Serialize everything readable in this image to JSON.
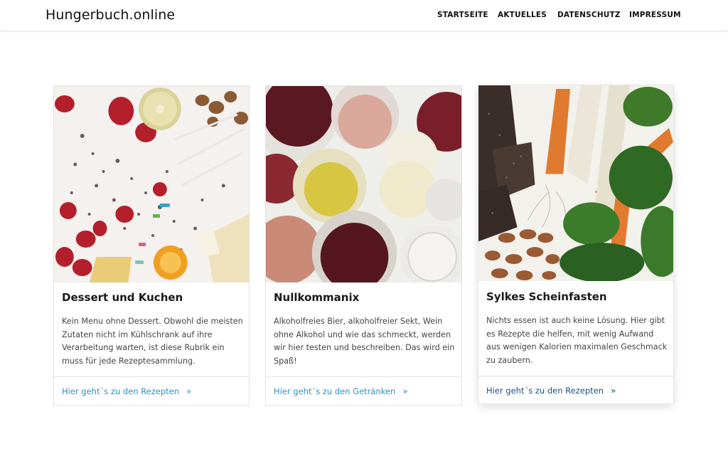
{
  "header": {
    "site_title": "Hungerbuch.online",
    "nav": [
      "STARTSEITE",
      "AKTUELLES",
      "DATENSCHUTZ",
      "IMPRESSUM"
    ]
  },
  "cards": [
    {
      "title": "Dessert und Kuchen",
      "text": "Kein Menu ohne Dessert. Obwohl die meisten Zutaten nicht im Kühlschrank auf ihre Verarbeitung warten, ist diese Rubrik ein muss für jede Rezeptesammlung.",
      "link": "Hier geht´s zu den Rezepten",
      "chevron": "»"
    },
    {
      "title": "Nullkommanix",
      "text": "Alkoholfreies Bier, alkoholfreier Sekt, Wein ohne Alkohol und wie das schmeckt, werden wir hier testen und beschreiben. Das wird ein Spaß!",
      "link": "Hier geht´s zu den Getränken",
      "chevron": "»"
    },
    {
      "title": "Sylkes Scheinfasten",
      "text": "Nichts essen ist auch keine Lösung. Hier gibt es Rezepte die helfen, mit wenig Aufwand aus wenigen Kalorien maximalen Geschmack zu zaubern.",
      "link": "Hier geht´s zu den Rezepten",
      "chevron": "»"
    }
  ],
  "colors": {
    "link": "#2f8fc4",
    "link_active": "#1b4f80",
    "border": "#e0e0e0"
  }
}
